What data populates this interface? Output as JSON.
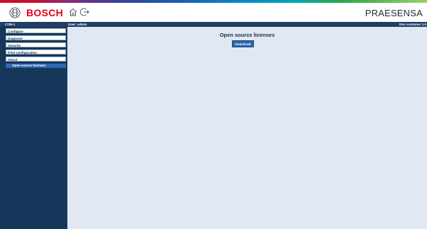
{
  "header": {
    "brand": "BOSCH",
    "product": "PRAESENSA",
    "icons": [
      "bosch-logo-icon",
      "home-icon",
      "logout-icon"
    ]
  },
  "topbar": {
    "device": "CON-1",
    "user": "User: admin",
    "customer": "Dev customer 1.0"
  },
  "sidebar": {
    "items": [
      {
        "label": "Configure"
      },
      {
        "label": "Diagnose"
      },
      {
        "label": "Security"
      },
      {
        "label": "Print configuration"
      },
      {
        "label": "About"
      }
    ],
    "sub_items": [
      {
        "label": "Open source licenses",
        "active": true
      }
    ]
  },
  "main": {
    "title": "Open source licenses",
    "download_label": "Download"
  },
  "colors": {
    "brand_red": "#e20015",
    "navy": "#14375a",
    "topbar": "#1d3f63",
    "content_bg": "#dfe8f3",
    "accent_blue": "#2a66ad"
  }
}
